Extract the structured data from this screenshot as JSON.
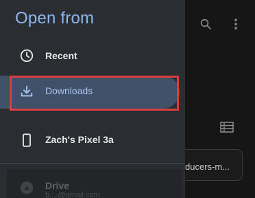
{
  "drawer": {
    "title": "Open from",
    "items": [
      {
        "label": "Recent",
        "icon": "clock-icon"
      },
      {
        "label": "Downloads",
        "icon": "download-icon",
        "selected": true
      },
      {
        "label": "Zach's Pixel 3a",
        "icon": "phone-icon"
      },
      {
        "label": "Drive",
        "icon": "drive-icon",
        "account": "b....@gmail.com"
      }
    ]
  },
  "background": {
    "file_name": "ducers-m..."
  },
  "colors": {
    "drawer_bg": "#2a2d31",
    "title": "#8fb6ee",
    "selected_bg": "#3f5068",
    "selected_text": "#a9c7f3",
    "annotation_border": "#d93f3f"
  }
}
